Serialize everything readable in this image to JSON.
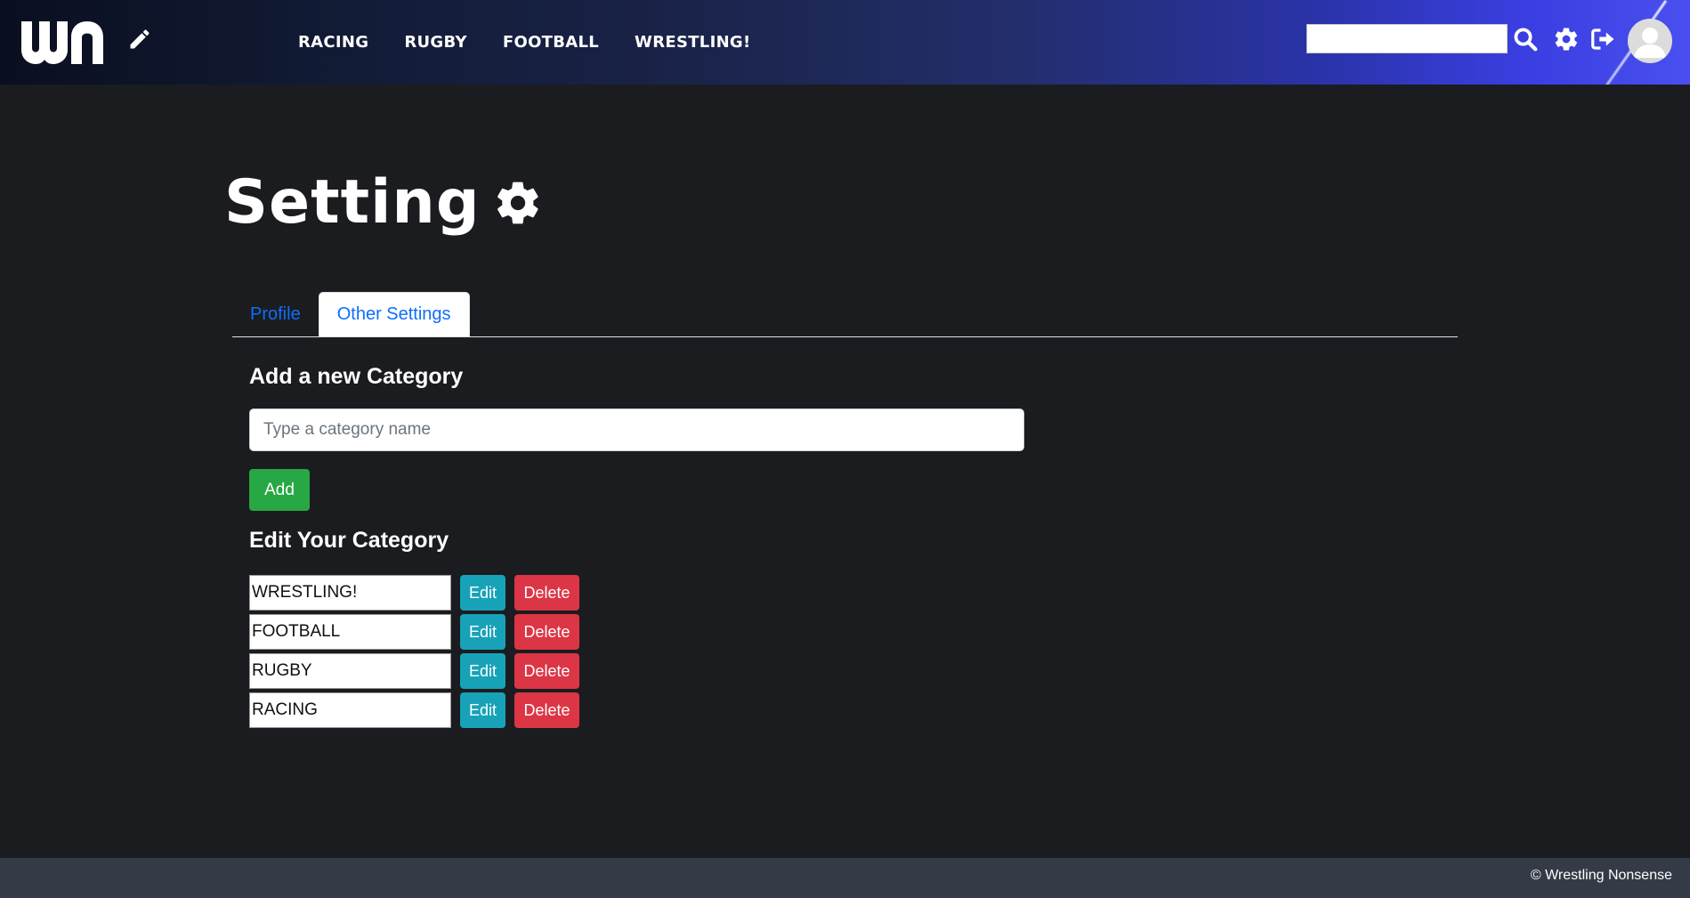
{
  "header": {
    "logo_text": "wn",
    "nav": [
      "RACING",
      "RUGBY",
      "FOOTBALL",
      "WRESTLING!"
    ],
    "search_placeholder": "",
    "icons": [
      "pencil-icon",
      "search-icon",
      "gear-icon",
      "logout-icon",
      "avatar-icon"
    ]
  },
  "page": {
    "title": "Setting",
    "tabs": [
      {
        "label": "Profile",
        "active": false
      },
      {
        "label": "Other Settings",
        "active": true
      }
    ]
  },
  "add_category": {
    "heading": "Add a new Category",
    "placeholder": "Type a category name",
    "button": "Add"
  },
  "edit_category": {
    "heading": "Edit Your Category",
    "edit_label": "Edit",
    "delete_label": "Delete",
    "items": [
      "WRESTLING!",
      "FOOTBALL",
      "RUGBY",
      "RACING"
    ]
  },
  "footer": {
    "text": "© Wrestling Nonsense"
  },
  "colors": {
    "accent_blue": "#0d6efd",
    "add_green": "#28a745",
    "edit_teal": "#17a2b8",
    "delete_red": "#dc3545",
    "background": "#1b1c1f"
  }
}
